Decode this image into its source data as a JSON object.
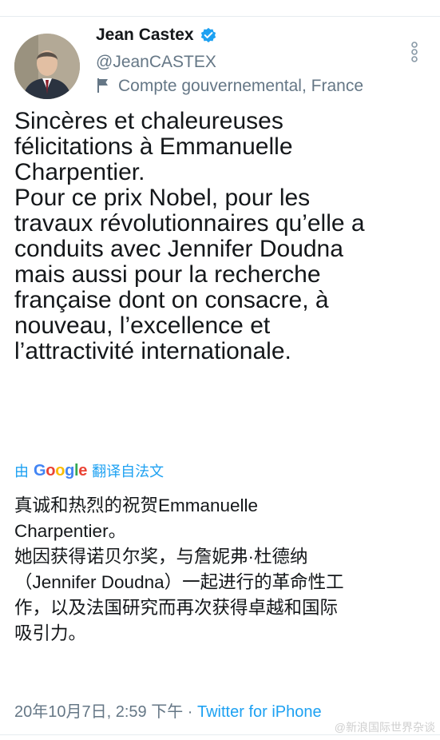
{
  "user": {
    "display_name": "Jean Castex",
    "handle": "@JeanCASTEX",
    "label": "Compte gouvernemental, France"
  },
  "tweet": {
    "text": "Sincères et chaleureuses\nfélicitations à Emmanuelle\nCharpentier.\nPour ce prix Nobel, pour les\ntravaux révolutionnaires qu’elle a\nconduits avec Jennifer Doudna\nmais aussi pour la recherche\nfrançaise dont on consacre, à\nnouveau, l’excellence et\nl’attractivité internationale."
  },
  "translate": {
    "prefix": "由",
    "provider": "Google",
    "suffix": "翻译自法文"
  },
  "translation": {
    "text": "真诚和热烈的祝贺Emmanuelle\nCharpentier。\n她因获得诺贝尔奖，与詹妮弗·杜德纳\n（Jennifer Doudna）一起进行的革命性工\n作，以及法国研究而再次获得卓越和国际\n吸引力。"
  },
  "meta": {
    "timestamp": "20年10月7日, 2:59 下午",
    "separator": " · ",
    "source": "Twitter for iPhone"
  },
  "watermark": "@新浪国际世界杂谈",
  "colors": {
    "accent": "#1da1f2",
    "secondary_text": "#657786",
    "text": "#14171a"
  },
  "icons": [
    "verified-badge-icon",
    "flag-icon",
    "more-vertical-icon"
  ]
}
